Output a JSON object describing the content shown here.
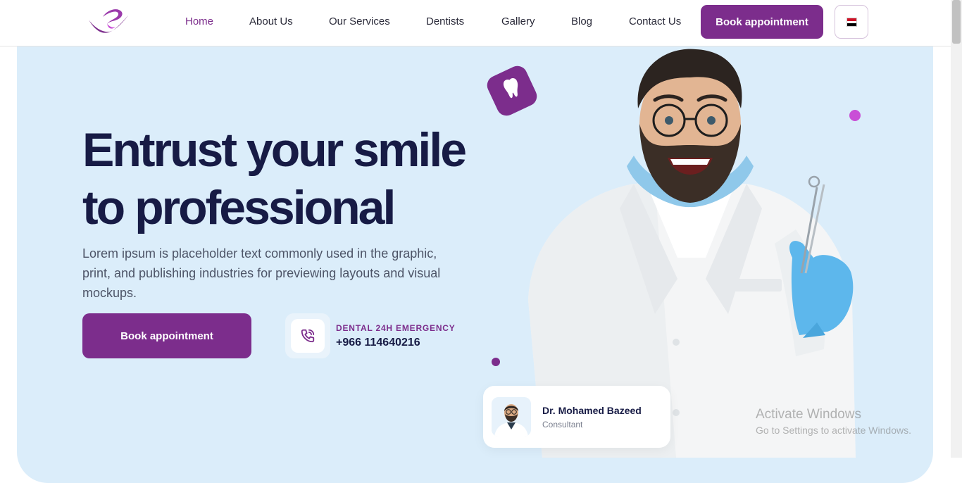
{
  "nav": {
    "links": [
      "Home",
      "About Us",
      "Our Services",
      "Dentists",
      "Gallery",
      "Blog",
      "Contact Us"
    ],
    "book_label": "Book appointment"
  },
  "hero": {
    "title_line1": "Entrust your smile",
    "title_line2": "to professional",
    "description": "Lorem ipsum is placeholder text commonly used in the graphic, print, and publishing industries for previewing layouts and visual mockups.",
    "book_label": "Book appointment",
    "emergency_label": "DENTAL 24H EMERGENCY",
    "emergency_phone": "+966 114640216"
  },
  "doctor_card": {
    "name": "Dr. Mohamed Bazeed",
    "role": "Consultant"
  },
  "watermark": {
    "title": "Activate Windows",
    "subtitle": "Go to Settings to activate Windows."
  },
  "colors": {
    "brand": "#7c2d8c",
    "heading": "#171b45",
    "hero_bg": "#dbedfa",
    "accent_dot": "#c94fd6"
  },
  "icons": {
    "logo": "logo-icon",
    "language": "egypt-flag-icon",
    "phone": "phone-call-icon",
    "tooth": "tooth-icon"
  }
}
